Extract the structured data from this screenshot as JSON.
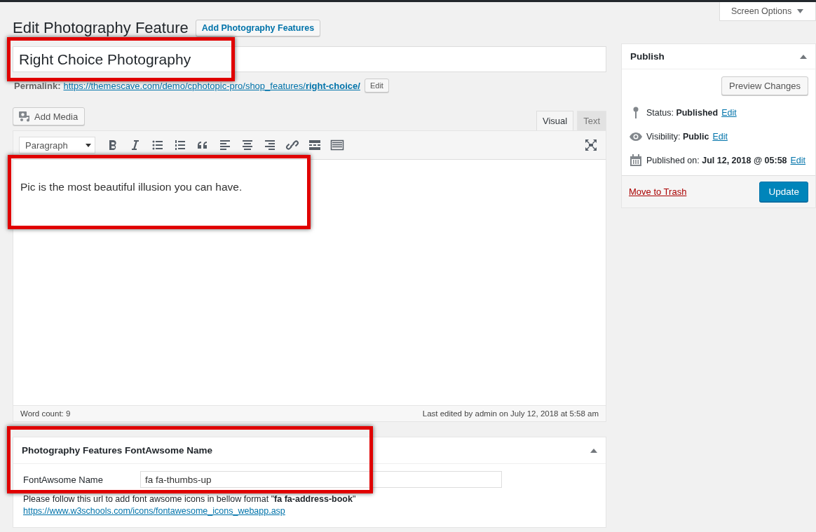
{
  "header": {
    "title": "Edit Photography Feature",
    "add_button": "Add Photography Features",
    "screen_options": "Screen Options"
  },
  "post_title": {
    "value": "Right Choice Photography",
    "highlighted": true
  },
  "permalink": {
    "label": "Permalink:",
    "url": "https://themescave.com/demo/cphotopic-pro/shop_features/**right-choice/**",
    "edit_button": "Edit"
  },
  "editor": {
    "add_media": "Add Media",
    "tabs": [
      {
        "label": "Visual",
        "selected": true
      },
      {
        "label": "Text",
        "selected": false
      }
    ],
    "format_select": "Paragraph",
    "content": "Pic is the most beautiful illusion you can have.",
    "highlighted": true,
    "word_count": "Word count: 9",
    "last_edited": "Last edited by admin on July 12, 2018 at 5:58 am"
  },
  "metabox": {
    "title": "Photography Features FontAwsome Name",
    "highlighted": true,
    "field_label": "FontAwsome Name",
    "field_value": "fa fa-thumbs-up",
    "help_text": "Please follow this url to add font awsome icons in bellow format \"**fa fa-address-book**\"",
    "help_link": [
      "https://www.w3schools.com/icons",
      "/fontawesome_icons_webapp.asp"
    ]
  },
  "publish": {
    "title": "Publish",
    "preview_button": "Preview Changes",
    "rows": [
      {
        "kind": "status",
        "text": "Status: **Published**",
        "edit": "Edit"
      },
      {
        "kind": "visibility",
        "text": "Visibility: **Public**",
        "edit": "Edit"
      },
      {
        "kind": "date",
        "text": "Published on: **Jul 12, 2018 @ 05:58**",
        "edit": "Edit"
      }
    ],
    "trash_link": "Move to Trash",
    "update_button": "Update"
  }
}
